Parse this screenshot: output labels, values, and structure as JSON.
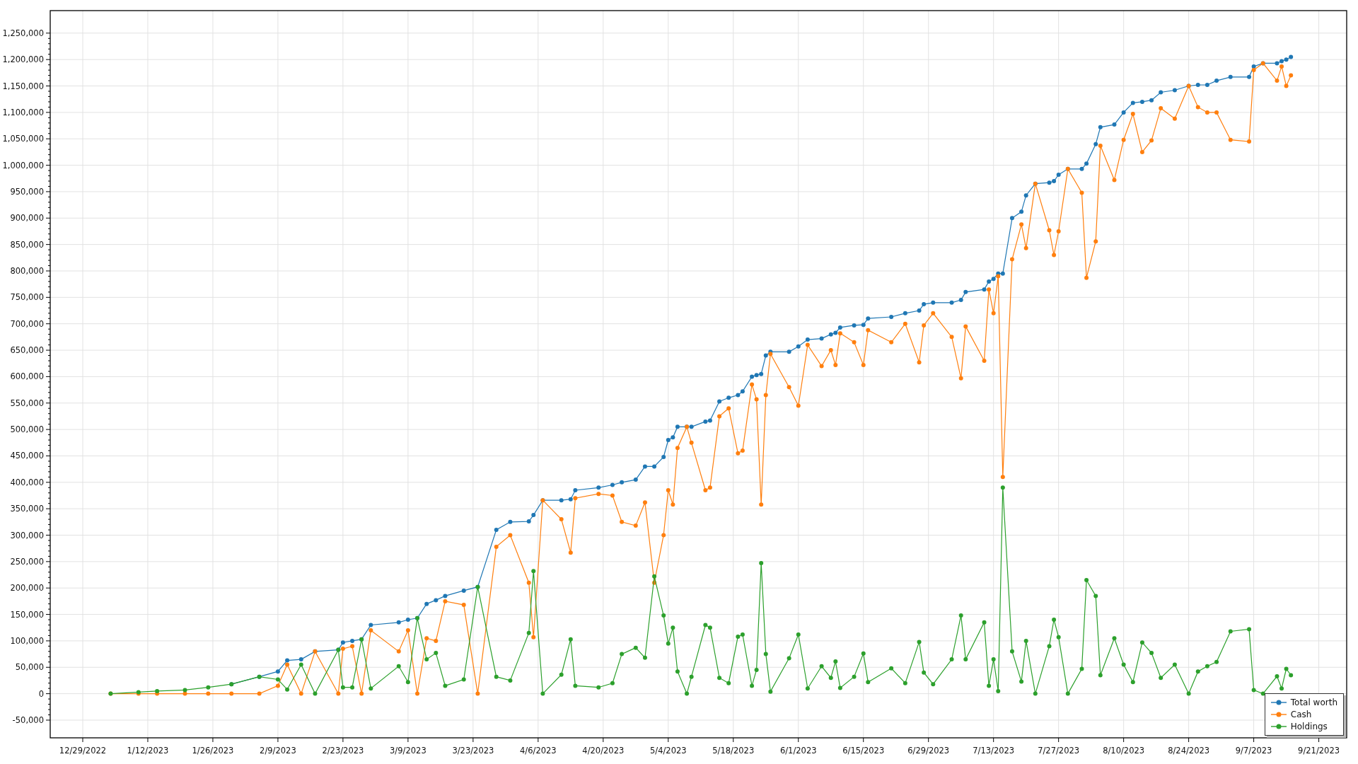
{
  "chart_data": {
    "type": "line",
    "grid": true,
    "x": [
      "2023-01-04",
      "2023-01-10",
      "2023-01-14",
      "2023-01-20",
      "2023-01-25",
      "2023-01-30",
      "2023-02-05",
      "2023-02-09",
      "2023-02-11",
      "2023-02-14",
      "2023-02-17",
      "2023-02-22",
      "2023-02-23",
      "2023-02-25",
      "2023-02-27",
      "2023-03-01",
      "2023-03-07",
      "2023-03-09",
      "2023-03-11",
      "2023-03-13",
      "2023-03-15",
      "2023-03-17",
      "2023-03-21",
      "2023-03-24",
      "2023-03-28",
      "2023-03-31",
      "2023-04-04",
      "2023-04-05",
      "2023-04-07",
      "2023-04-11",
      "2023-04-13",
      "2023-04-14",
      "2023-04-19",
      "2023-04-22",
      "2023-04-24",
      "2023-04-27",
      "2023-04-29",
      "2023-05-01",
      "2023-05-03",
      "2023-05-04",
      "2023-05-05",
      "2023-05-06",
      "2023-05-08",
      "2023-05-09",
      "2023-05-12",
      "2023-05-13",
      "2023-05-15",
      "2023-05-17",
      "2023-05-19",
      "2023-05-20",
      "2023-05-22",
      "2023-05-23",
      "2023-05-24",
      "2023-05-25",
      "2023-05-26",
      "2023-05-30",
      "2023-06-01",
      "2023-06-03",
      "2023-06-06",
      "2023-06-08",
      "2023-06-09",
      "2023-06-10",
      "2023-06-13",
      "2023-06-15",
      "2023-06-16",
      "2023-06-21",
      "2023-06-24",
      "2023-06-27",
      "2023-06-28",
      "2023-06-30",
      "2023-07-04",
      "2023-07-06",
      "2023-07-07",
      "2023-07-11",
      "2023-07-12",
      "2023-07-13",
      "2023-07-14",
      "2023-07-15",
      "2023-07-17",
      "2023-07-19",
      "2023-07-20",
      "2023-07-22",
      "2023-07-25",
      "2023-07-26",
      "2023-07-27",
      "2023-07-29",
      "2023-08-01",
      "2023-08-02",
      "2023-08-04",
      "2023-08-05",
      "2023-08-08",
      "2023-08-10",
      "2023-08-12",
      "2023-08-14",
      "2023-08-16",
      "2023-08-18",
      "2023-08-21",
      "2023-08-24",
      "2023-08-26",
      "2023-08-28",
      "2023-08-30",
      "2023-09-02",
      "2023-09-06",
      "2023-09-07",
      "2023-09-09",
      "2023-09-12",
      "2023-09-13",
      "2023-09-14",
      "2023-09-15"
    ],
    "series": [
      {
        "name": "Total worth",
        "color": "#1f77b4",
        "marker": "circle",
        "values": [
          null,
          null,
          null,
          null,
          null,
          18000,
          32000,
          42000,
          63000,
          65000,
          80000,
          83000,
          97000,
          100000,
          103000,
          130000,
          135000,
          140000,
          143000,
          170000,
          177000,
          185000,
          195000,
          202000,
          310000,
          325000,
          326000,
          338000,
          366000,
          366000,
          368000,
          385000,
          390000,
          395000,
          400000,
          405000,
          430000,
          430000,
          448000,
          480000,
          485000,
          505000,
          505000,
          505000,
          515000,
          517000,
          553000,
          560000,
          565000,
          572000,
          600000,
          603000,
          605000,
          640000,
          647000,
          647000,
          657000,
          670000,
          672000,
          680000,
          683000,
          693000,
          697000,
          698000,
          710000,
          713000,
          720000,
          725000,
          737000,
          740000,
          740000,
          745000,
          760000,
          765000,
          780000,
          785000,
          795000,
          795000,
          900000,
          912000,
          943000,
          965000,
          967000,
          970000,
          982000,
          993000,
          993000,
          1003000,
          1040000,
          1072000,
          1077000,
          1100000,
          1118000,
          1120000,
          1123000,
          1138000,
          1142000,
          1150000,
          1152000,
          1152000,
          1160000,
          1167000,
          1167000,
          1187000,
          1193000,
          1193000,
          1197000,
          1200000,
          1205000
        ]
      },
      {
        "name": "Cash",
        "color": "#ff7f0e",
        "marker": "circle",
        "values": [
          0,
          0,
          0,
          0,
          0,
          0,
          0,
          15000,
          55000,
          0,
          80000,
          0,
          85000,
          90000,
          0,
          120000,
          80000,
          120000,
          0,
          105000,
          100000,
          175000,
          168000,
          0,
          278000,
          300000,
          210000,
          107000,
          366000,
          330000,
          267000,
          370000,
          378000,
          375000,
          325000,
          318000,
          362000,
          210000,
          300000,
          385000,
          358000,
          465000,
          505000,
          475000,
          385000,
          390000,
          525000,
          540000,
          455000,
          460000,
          585000,
          557000,
          358000,
          565000,
          643000,
          580000,
          545000,
          660000,
          620000,
          650000,
          622000,
          682000,
          665000,
          622000,
          688000,
          665000,
          700000,
          627000,
          697000,
          720000,
          675000,
          597000,
          695000,
          630000,
          765000,
          720000,
          790000,
          410000,
          822000,
          888000,
          843000,
          965000,
          877000,
          830000,
          875000,
          993000,
          948000,
          787000,
          856000,
          1037000,
          972000,
          1048000,
          1097000,
          1025000,
          1047000,
          1108000,
          1088000,
          1150000,
          1110000,
          1100000,
          1100000,
          1048000,
          1045000,
          1180000,
          1193000,
          1160000,
          1187000,
          1150000,
          1170000
        ]
      },
      {
        "name": "Holdings",
        "color": "#2ca02c",
        "marker": "circle",
        "values": [
          0,
          3000,
          5000,
          7000,
          12000,
          18000,
          32000,
          27000,
          8000,
          55000,
          0,
          83000,
          12000,
          12000,
          103000,
          10000,
          52000,
          22000,
          143000,
          65000,
          77000,
          15000,
          27000,
          202000,
          32000,
          25000,
          115000,
          232000,
          0,
          36000,
          103000,
          15000,
          12000,
          20000,
          75000,
          87000,
          68000,
          222000,
          148000,
          95000,
          125000,
          42000,
          0,
          32000,
          130000,
          125000,
          30000,
          20000,
          108000,
          112000,
          15000,
          45000,
          247000,
          75000,
          4000,
          67000,
          112000,
          10000,
          52000,
          30000,
          61000,
          11000,
          32000,
          76000,
          22000,
          48000,
          20000,
          98000,
          40000,
          18000,
          65000,
          148000,
          65000,
          135000,
          15000,
          65000,
          5000,
          390000,
          80000,
          23000,
          100000,
          0,
          90000,
          140000,
          107000,
          0,
          47000,
          215000,
          185000,
          35000,
          105000,
          55000,
          22000,
          97000,
          77000,
          30000,
          55000,
          0,
          42000,
          52000,
          60000,
          118000,
          122000,
          7000,
          0,
          33000,
          10000,
          47000,
          35000
        ]
      }
    ],
    "xlim": [
      "2022-12-22",
      "2023-09-27"
    ],
    "ylim": [
      -83500,
      1292600
    ],
    "xticks": [
      {
        "value": "2022-12-29",
        "label": "12/29/2022"
      },
      {
        "value": "2023-01-12",
        "label": "1/12/2023"
      },
      {
        "value": "2023-01-26",
        "label": "1/26/2023"
      },
      {
        "value": "2023-02-09",
        "label": "2/9/2023"
      },
      {
        "value": "2023-02-23",
        "label": "2/23/2023"
      },
      {
        "value": "2023-03-09",
        "label": "3/9/2023"
      },
      {
        "value": "2023-03-23",
        "label": "3/23/2023"
      },
      {
        "value": "2023-04-06",
        "label": "4/6/2023"
      },
      {
        "value": "2023-04-20",
        "label": "4/20/2023"
      },
      {
        "value": "2023-05-04",
        "label": "5/4/2023"
      },
      {
        "value": "2023-05-18",
        "label": "5/18/2023"
      },
      {
        "value": "2023-06-01",
        "label": "6/1/2023"
      },
      {
        "value": "2023-06-15",
        "label": "6/15/2023"
      },
      {
        "value": "2023-06-29",
        "label": "6/29/2023"
      },
      {
        "value": "2023-07-13",
        "label": "7/13/2023"
      },
      {
        "value": "2023-07-27",
        "label": "7/27/2023"
      },
      {
        "value": "2023-08-10",
        "label": "8/10/2023"
      },
      {
        "value": "2023-08-24",
        "label": "8/24/2023"
      },
      {
        "value": "2023-09-07",
        "label": "9/7/2023"
      },
      {
        "value": "2023-09-21",
        "label": "9/21/2023"
      }
    ],
    "yticks": [
      {
        "value": -50000,
        "label": "-50,000"
      },
      {
        "value": 0,
        "label": "0"
      },
      {
        "value": 50000,
        "label": "50,000"
      },
      {
        "value": 100000,
        "label": "100,000"
      },
      {
        "value": 150000,
        "label": "150,000"
      },
      {
        "value": 200000,
        "label": "200,000"
      },
      {
        "value": 250000,
        "label": "250,000"
      },
      {
        "value": 300000,
        "label": "300,000"
      },
      {
        "value": 350000,
        "label": "350,000"
      },
      {
        "value": 400000,
        "label": "400,000"
      },
      {
        "value": 450000,
        "label": "450,000"
      },
      {
        "value": 500000,
        "label": "500,000"
      },
      {
        "value": 550000,
        "label": "550,000"
      },
      {
        "value": 600000,
        "label": "600,000"
      },
      {
        "value": 650000,
        "label": "650,000"
      },
      {
        "value": 700000,
        "label": "700,000"
      },
      {
        "value": 750000,
        "label": "750,000"
      },
      {
        "value": 800000,
        "label": "800,000"
      },
      {
        "value": 850000,
        "label": "850,000"
      },
      {
        "value": 900000,
        "label": "900,000"
      },
      {
        "value": 950000,
        "label": "950,000"
      },
      {
        "value": 1000000,
        "label": "1,000,000"
      },
      {
        "value": 1050000,
        "label": "1,050,000"
      },
      {
        "value": 1100000,
        "label": "1,100,000"
      },
      {
        "value": 1150000,
        "label": "1,150,000"
      },
      {
        "value": 1200000,
        "label": "1,200,000"
      },
      {
        "value": 1250000,
        "label": "1,250,000"
      }
    ]
  }
}
